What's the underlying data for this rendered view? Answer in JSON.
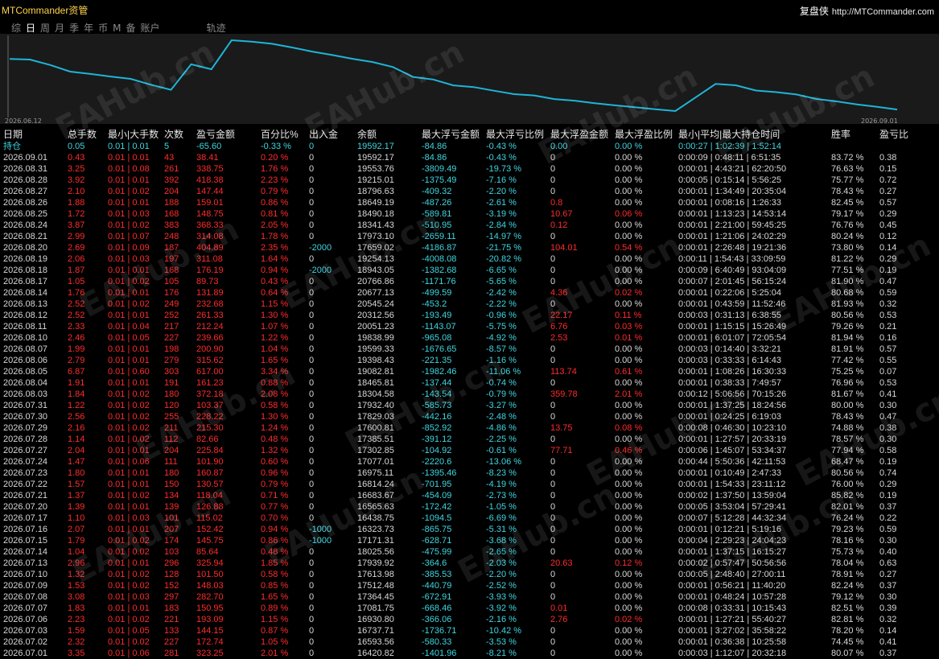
{
  "app": {
    "title": "MTCommander资管",
    "brand_cn": "复盘侠",
    "brand_url": "http://MTCommander.com"
  },
  "tabs": [
    "综",
    "日",
    "周",
    "月",
    "季",
    "年",
    "币",
    "M",
    "备",
    "账户",
    "轨迹"
  ],
  "active_tab": "日",
  "chart": {
    "start_date": "2026.06.12",
    "end_date": "2026.09.01",
    "line_color": "#1fb4d6",
    "equity": [
      16420.82,
      16593.56,
      16737.71,
      16930.8,
      17081.75,
      17364.45,
      17512.48,
      17613.98,
      17939.92,
      18025.56,
      17171.31,
      16323.73,
      16438.75,
      16565.63,
      16683.67,
      16814.24,
      16975.11,
      17077.01,
      17302.85,
      17385.51,
      17600.81,
      17829.03,
      17932.4,
      18304.58,
      18465.81,
      19082.81,
      19398.43,
      19599.33,
      19838.99,
      20051.23,
      20312.56,
      20545.24,
      20677.13,
      20766.86,
      18943.05,
      19254.13,
      17659.02,
      17973.1,
      18341.43,
      18490.18,
      18649.19,
      18796.63,
      19215.01,
      19553.76,
      19592.17
    ]
  },
  "columns": [
    "日期",
    "总手数",
    "最小|大手数",
    "次数",
    "盈亏金额",
    "百分比%",
    "出入金",
    "余额",
    "最大浮亏金额",
    "最大浮亏比例",
    "最大浮盈金额",
    "最大浮盈比例",
    "最小|平均|最大持仓时间",
    "胜率",
    "盈亏比"
  ],
  "summary": {
    "label": "持仓",
    "lots": "0.05",
    "minmax": "0.01 | 0.01",
    "count": "5",
    "pnl": "-65.60",
    "pct": "-0.33 %",
    "flow": "0",
    "balance": "19592.17",
    "max_dd": "-84.86",
    "max_dd_pct": "-0.43 %",
    "max_fp": "0.00",
    "max_fp_pct": "0.00 %",
    "hold": "0:00:27 | 1:02:39 | 1:52:14",
    "win": "",
    "ratio": ""
  },
  "rows": [
    [
      "2026.09.01",
      "0.43",
      "0.01 | 0.01",
      "43",
      "38.41",
      "0.20 %",
      "0",
      "19592.17",
      "-84.86",
      "-0.43 %",
      "0",
      "0.00 %",
      "0:00:09 | 0:48:11 | 6:51:35",
      "83.72 %",
      "0.38"
    ],
    [
      "2026.08.31",
      "3.25",
      "0.01 | 0.08",
      "261",
      "338.75",
      "1.76 %",
      "0",
      "19553.76",
      "-3809.49",
      "-19.73 %",
      "0",
      "0.00 %",
      "0:00:01 | 4:43:21 | 62:20:50",
      "76.63 %",
      "0.15"
    ],
    [
      "2026.08.28",
      "3.92",
      "0.01 | 0.01",
      "392",
      "418.38",
      "2.23 %",
      "0",
      "19215.01",
      "-1375.49",
      "-7.16 %",
      "0",
      "0.00 %",
      "0:00:05 | 0:15:14 | 5:56:25",
      "75.77 %",
      "0.72"
    ],
    [
      "2026.08.27",
      "2.10",
      "0.01 | 0.02",
      "204",
      "147.44",
      "0.79 %",
      "0",
      "18796.63",
      "-409.32",
      "-2.20 %",
      "0",
      "0.00 %",
      "0:00:01 | 1:34:49 | 20:35:04",
      "78.43 %",
      "0.27"
    ],
    [
      "2026.08.26",
      "1.88",
      "0.01 | 0.01",
      "188",
      "159.01",
      "0.86 %",
      "0",
      "18649.19",
      "-487.26",
      "-2.61 %",
      "0.8",
      "0.00 %",
      "0:00:01 | 0:08:16 | 1:26:33",
      "82.45 %",
      "0.57"
    ],
    [
      "2026.08.25",
      "1.72",
      "0.01 | 0.03",
      "168",
      "148.75",
      "0.81 %",
      "0",
      "18490.18",
      "-589.81",
      "-3.19 %",
      "10.67",
      "0.06 %",
      "0:00:01 | 1:13:23 | 14:53:14",
      "79.17 %",
      "0.29"
    ],
    [
      "2026.08.24",
      "3.87",
      "0.01 | 0.02",
      "383",
      "368.33",
      "2.05 %",
      "0",
      "18341.43",
      "-510.95",
      "-2.84 %",
      "0.12",
      "0.00 %",
      "0:00:01 | 2:21:00 | 59:45:25",
      "76.76 %",
      "0.45"
    ],
    [
      "2026.08.21",
      "2.99",
      "0.01 | 0.07",
      "248",
      "314.08",
      "1.78 %",
      "0",
      "17973.10",
      "-2659.11",
      "-14.97 %",
      "0",
      "0.00 %",
      "0:00:01 | 1:21:06 | 24:02:29",
      "80.24 %",
      "0.12"
    ],
    [
      "2026.08.20",
      "2.69",
      "0.01 | 0.09",
      "187",
      "404.89",
      "2.35 %",
      "-2000",
      "17659.02",
      "-4186.87",
      "-21.75 %",
      "104.01",
      "0.54 %",
      "0:00:01 | 2:26:48 | 19:21:36",
      "73.80 %",
      "0.14"
    ],
    [
      "2026.08.19",
      "2.06",
      "0.01 | 0.03",
      "197",
      "311.08",
      "1.64 %",
      "0",
      "19254.13",
      "-4008.08",
      "-20.82 %",
      "0",
      "0.00 %",
      "0:00:11 | 1:54:43 | 33:09:59",
      "81.22 %",
      "0.29"
    ],
    [
      "2026.08.18",
      "1.87",
      "0.01 | 0.01",
      "168",
      "176.19",
      "0.94 %",
      "-2000",
      "18943.05",
      "-1382.68",
      "-6.65 %",
      "0",
      "0.00 %",
      "0:00:09 | 6:40:49 | 93:04:09",
      "77.51 %",
      "0.19"
    ],
    [
      "2026.08.17",
      "1.05",
      "0.01 | 0.02",
      "105",
      "89.73",
      "0.43 %",
      "0",
      "20766.86",
      "-1171.76",
      "-5.65 %",
      "0",
      "0.00 %",
      "0:00:07 | 2:01:45 | 56:15:24",
      "81.90 %",
      "0.47"
    ],
    [
      "2026.08.14",
      "1.76",
      "0.01 | 0.01",
      "176",
      "131.89",
      "0.64 %",
      "0",
      "20677.13",
      "-499.59",
      "-2.42 %",
      "4.36",
      "0.02 %",
      "0:00:01 | 0:22:06 | 5:25:04",
      "80.68 %",
      "0.59"
    ],
    [
      "2026.08.13",
      "2.52",
      "0.01 | 0.02",
      "249",
      "232.68",
      "1.15 %",
      "0",
      "20545.24",
      "-453.2",
      "-2.22 %",
      "0",
      "0.00 %",
      "0:00:01 | 0:43:59 | 11:52:46",
      "81.93 %",
      "0.32"
    ],
    [
      "2026.08.12",
      "2.52",
      "0.01 | 0.01",
      "252",
      "261.33",
      "1.30 %",
      "0",
      "20312.56",
      "-193.49",
      "-0.96 %",
      "22.17",
      "0.11 %",
      "0:00:03 | 0:31:13 | 6:38:55",
      "80.56 %",
      "0.53"
    ],
    [
      "2026.08.11",
      "2.33",
      "0.01 | 0.04",
      "217",
      "212.24",
      "1.07 %",
      "0",
      "20051.23",
      "-1143.07",
      "-5.75 %",
      "6.76",
      "0.03 %",
      "0:00:01 | 1:15:15 | 15:26:49",
      "79.26 %",
      "0.21"
    ],
    [
      "2026.08.10",
      "2.46",
      "0.01 | 0.05",
      "227",
      "239.66",
      "1.22 %",
      "0",
      "19838.99",
      "-965.08",
      "-4.92 %",
      "2.53",
      "0.01 %",
      "0:00:01 | 6:01:07 | 72:05:54",
      "81.94 %",
      "0.16"
    ],
    [
      "2026.08.07",
      "1.99",
      "0.01 | 0.01",
      "198",
      "200.90",
      "1.04 %",
      "0",
      "19599.33",
      "-1676.65",
      "-8.57 %",
      "0",
      "0.00 %",
      "0:00:03 | 0:14:40 | 3:32:21",
      "81.91 %",
      "0.57"
    ],
    [
      "2026.08.06",
      "2.79",
      "0.01 | 0.01",
      "279",
      "315.62",
      "1.65 %",
      "0",
      "19398.43",
      "-221.35",
      "-1.16 %",
      "0",
      "0.00 %",
      "0:00:03 | 0:33:33 | 6:14:43",
      "77.42 %",
      "0.55"
    ],
    [
      "2026.08.05",
      "6.87",
      "0.01 | 0.60",
      "303",
      "617.00",
      "3.34 %",
      "0",
      "19082.81",
      "-1982.46",
      "-11.06 %",
      "113.74",
      "0.61 %",
      "0:00:01 | 1:08:26 | 16:30:33",
      "75.25 %",
      "0.07"
    ],
    [
      "2026.08.04",
      "1.91",
      "0.01 | 0.01",
      "191",
      "161.23",
      "0.88 %",
      "0",
      "18465.81",
      "-137.44",
      "-0.74 %",
      "0",
      "0.00 %",
      "0:00:01 | 0:38:33 | 7:49:57",
      "76.96 %",
      "0.53"
    ],
    [
      "2026.08.03",
      "1.84",
      "0.01 | 0.02",
      "180",
      "372.18",
      "2.08 %",
      "0",
      "18304.58",
      "-143.54",
      "-0.79 %",
      "359.78",
      "2.01 %",
      "0:00:12 | 5:06:56 | 70:15:26",
      "81.67 %",
      "0.41"
    ],
    [
      "2026.07.31",
      "1.22",
      "0.01 | 0.02",
      "120",
      "103.37",
      "0.58 %",
      "0",
      "17932.40",
      "-585.73",
      "-3.27 %",
      "0",
      "0.00 %",
      "0:00:01 | 1:37:25 | 18:24:56",
      "80.00 %",
      "0.30"
    ],
    [
      "2026.07.30",
      "2.56",
      "0.01 | 0.02",
      "255",
      "228.22",
      "1.30 %",
      "0",
      "17829.03",
      "-442.16",
      "-2.48 %",
      "0",
      "0.00 %",
      "0:00:01 | 0:24:25 | 6:19:03",
      "78.43 %",
      "0.47"
    ],
    [
      "2026.07.29",
      "2.16",
      "0.01 | 0.02",
      "211",
      "215.30",
      "1.24 %",
      "0",
      "17600.81",
      "-852.92",
      "-4.86 %",
      "13.75",
      "0.08 %",
      "0:00:08 | 0:46:30 | 10:23:10",
      "74.88 %",
      "0.38"
    ],
    [
      "2026.07.28",
      "1.14",
      "0.01 | 0.02",
      "112",
      "82.66",
      "0.48 %",
      "0",
      "17385.51",
      "-391.12",
      "-2.25 %",
      "0",
      "0.00 %",
      "0:00:01 | 1:27:57 | 20:33:19",
      "78.57 %",
      "0.30"
    ],
    [
      "2026.07.27",
      "2.04",
      "0.01 | 0.01",
      "204",
      "225.84",
      "1.32 %",
      "0",
      "17302.85",
      "-104.92",
      "-0.61 %",
      "77.71",
      "0.46 %",
      "0:00:06 | 1:45:07 | 53:34:37",
      "77.94 %",
      "0.58"
    ],
    [
      "2026.07.24",
      "1.47",
      "0.01 | 0.06",
      "111",
      "101.90",
      "0.60 %",
      "0",
      "17077.01",
      "-2220.6",
      "-13.06 %",
      "0",
      "0.00 %",
      "0:00:44 | 5:50:36 | 42:11:53",
      "68.47 %",
      "0.19"
    ],
    [
      "2026.07.23",
      "1.80",
      "0.01 | 0.01",
      "180",
      "160.87",
      "0.96 %",
      "0",
      "16975.11",
      "-1395.46",
      "-8.23 %",
      "0",
      "0.00 %",
      "0:00:01 | 0:10:49 | 2:47:33",
      "80.56 %",
      "0.74"
    ],
    [
      "2026.07.22",
      "1.57",
      "0.01 | 0.01",
      "150",
      "130.57",
      "0.79 %",
      "0",
      "16814.24",
      "-701.95",
      "-4.19 %",
      "0",
      "0.00 %",
      "0:00:01 | 1:54:33 | 23:11:12",
      "76.00 %",
      "0.29"
    ],
    [
      "2026.07.21",
      "1.37",
      "0.01 | 0.02",
      "134",
      "118.04",
      "0.71 %",
      "0",
      "16683.67",
      "-454.09",
      "-2.73 %",
      "0",
      "0.00 %",
      "0:00:02 | 1:37:50 | 13:59:04",
      "85.82 %",
      "0.19"
    ],
    [
      "2026.07.20",
      "1.39",
      "0.01 | 0.01",
      "139",
      "126.88",
      "0.77 %",
      "0",
      "16565.63",
      "-172.42",
      "-1.05 %",
      "0",
      "0.00 %",
      "0:00:05 | 3:53:04 | 57:29:41",
      "82.01 %",
      "0.37"
    ],
    [
      "2026.07.17",
      "1.10",
      "0.01 | 0.03",
      "101",
      "115.02",
      "0.70 %",
      "0",
      "16438.75",
      "-1094.5",
      "-6.69 %",
      "0",
      "0.00 %",
      "0:00:07 | 5:12:28 | 44:32:34",
      "76.24 %",
      "0.22"
    ],
    [
      "2026.07.16",
      "2.07",
      "0.01 | 0.01",
      "207",
      "152.42",
      "0.94 %",
      "-1000",
      "16323.73",
      "-865.75",
      "-5.31 %",
      "0",
      "0.00 %",
      "0:00:01 | 0:12:21 | 5:19:16",
      "79.23 %",
      "0.59"
    ],
    [
      "2026.07.15",
      "1.79",
      "0.01 | 0.02",
      "174",
      "145.75",
      "0.86 %",
      "-1000",
      "17171.31",
      "-628.71",
      "-3.68 %",
      "0",
      "0.00 %",
      "0:00:04 | 2:29:23 | 24:04:23",
      "78.16 %",
      "0.30"
    ],
    [
      "2026.07.14",
      "1.04",
      "0.01 | 0.02",
      "103",
      "85.64",
      "0.48 %",
      "0",
      "18025.56",
      "-475.99",
      "-2.65 %",
      "0",
      "0.00 %",
      "0:00:01 | 1:37:15 | 16:15:27",
      "75.73 %",
      "0.40"
    ],
    [
      "2026.07.13",
      "2.96",
      "0.01 | 0.01",
      "296",
      "325.94",
      "1.85 %",
      "0",
      "17939.92",
      "-364.6",
      "-2.03 %",
      "20.63",
      "0.12 %",
      "0:00:02 | 0:57:47 | 50:56:56",
      "78.04 %",
      "0.63"
    ],
    [
      "2026.07.10",
      "1.32",
      "0.01 | 0.02",
      "128",
      "101.50",
      "0.58 %",
      "0",
      "17613.98",
      "-385.53",
      "-2.20 %",
      "0",
      "0.00 %",
      "0:00:05 | 2:48:40 | 27:00:11",
      "78.91 %",
      "0.27"
    ],
    [
      "2026.07.09",
      "1.53",
      "0.01 | 0.02",
      "152",
      "148.03",
      "0.85 %",
      "0",
      "17512.48",
      "-440.79",
      "-2.52 %",
      "0",
      "0.00 %",
      "0:00:01 | 0:56:21 | 11:40:20",
      "82.24 %",
      "0.37"
    ],
    [
      "2026.07.08",
      "3.08",
      "0.01 | 0.03",
      "297",
      "282.70",
      "1.65 %",
      "0",
      "17364.45",
      "-672.91",
      "-3.93 %",
      "0",
      "0.00 %",
      "0:00:01 | 0:48:24 | 10:57:28",
      "79.12 %",
      "0.30"
    ],
    [
      "2026.07.07",
      "1.83",
      "0.01 | 0.01",
      "183",
      "150.95",
      "0.89 %",
      "0",
      "17081.75",
      "-668.46",
      "-3.92 %",
      "0.01",
      "0.00 %",
      "0:00:08 | 0:33:31 | 10:15:43",
      "82.51 %",
      "0.39"
    ],
    [
      "2026.07.06",
      "2.23",
      "0.01 | 0.02",
      "221",
      "193.09",
      "1.15 %",
      "0",
      "16930.80",
      "-366.06",
      "-2.16 %",
      "2.76",
      "0.02 %",
      "0:00:01 | 1:27:21 | 55:40:27",
      "82.81 %",
      "0.32"
    ],
    [
      "2026.07.03",
      "1.59",
      "0.01 | 0.05",
      "133",
      "144.15",
      "0.87 %",
      "0",
      "16737.71",
      "-1736.71",
      "-10.42 %",
      "0",
      "0.00 %",
      "0:00:01 | 3:27:02 | 35:58:22",
      "78.20 %",
      "0.14"
    ],
    [
      "2026.07.02",
      "2.32",
      "0.01 | 0.02",
      "227",
      "172.74",
      "1.05 %",
      "0",
      "16593.56",
      "-580.33",
      "-3.53 %",
      "0",
      "0.00 %",
      "0:00:01 | 0:36:38 | 10:25:58",
      "74.45 %",
      "0.41"
    ],
    [
      "2026.07.01",
      "3.35",
      "0.01 | 0.06",
      "281",
      "323.25",
      "2.01 %",
      "0",
      "16420.82",
      "-1401.96",
      "-8.21 %",
      "0",
      "0.00 %",
      "0:00:03 | 1:12:07 | 20:32:18",
      "80.07 %",
      "0.37"
    ]
  ],
  "watermark": "EAHub.cn"
}
